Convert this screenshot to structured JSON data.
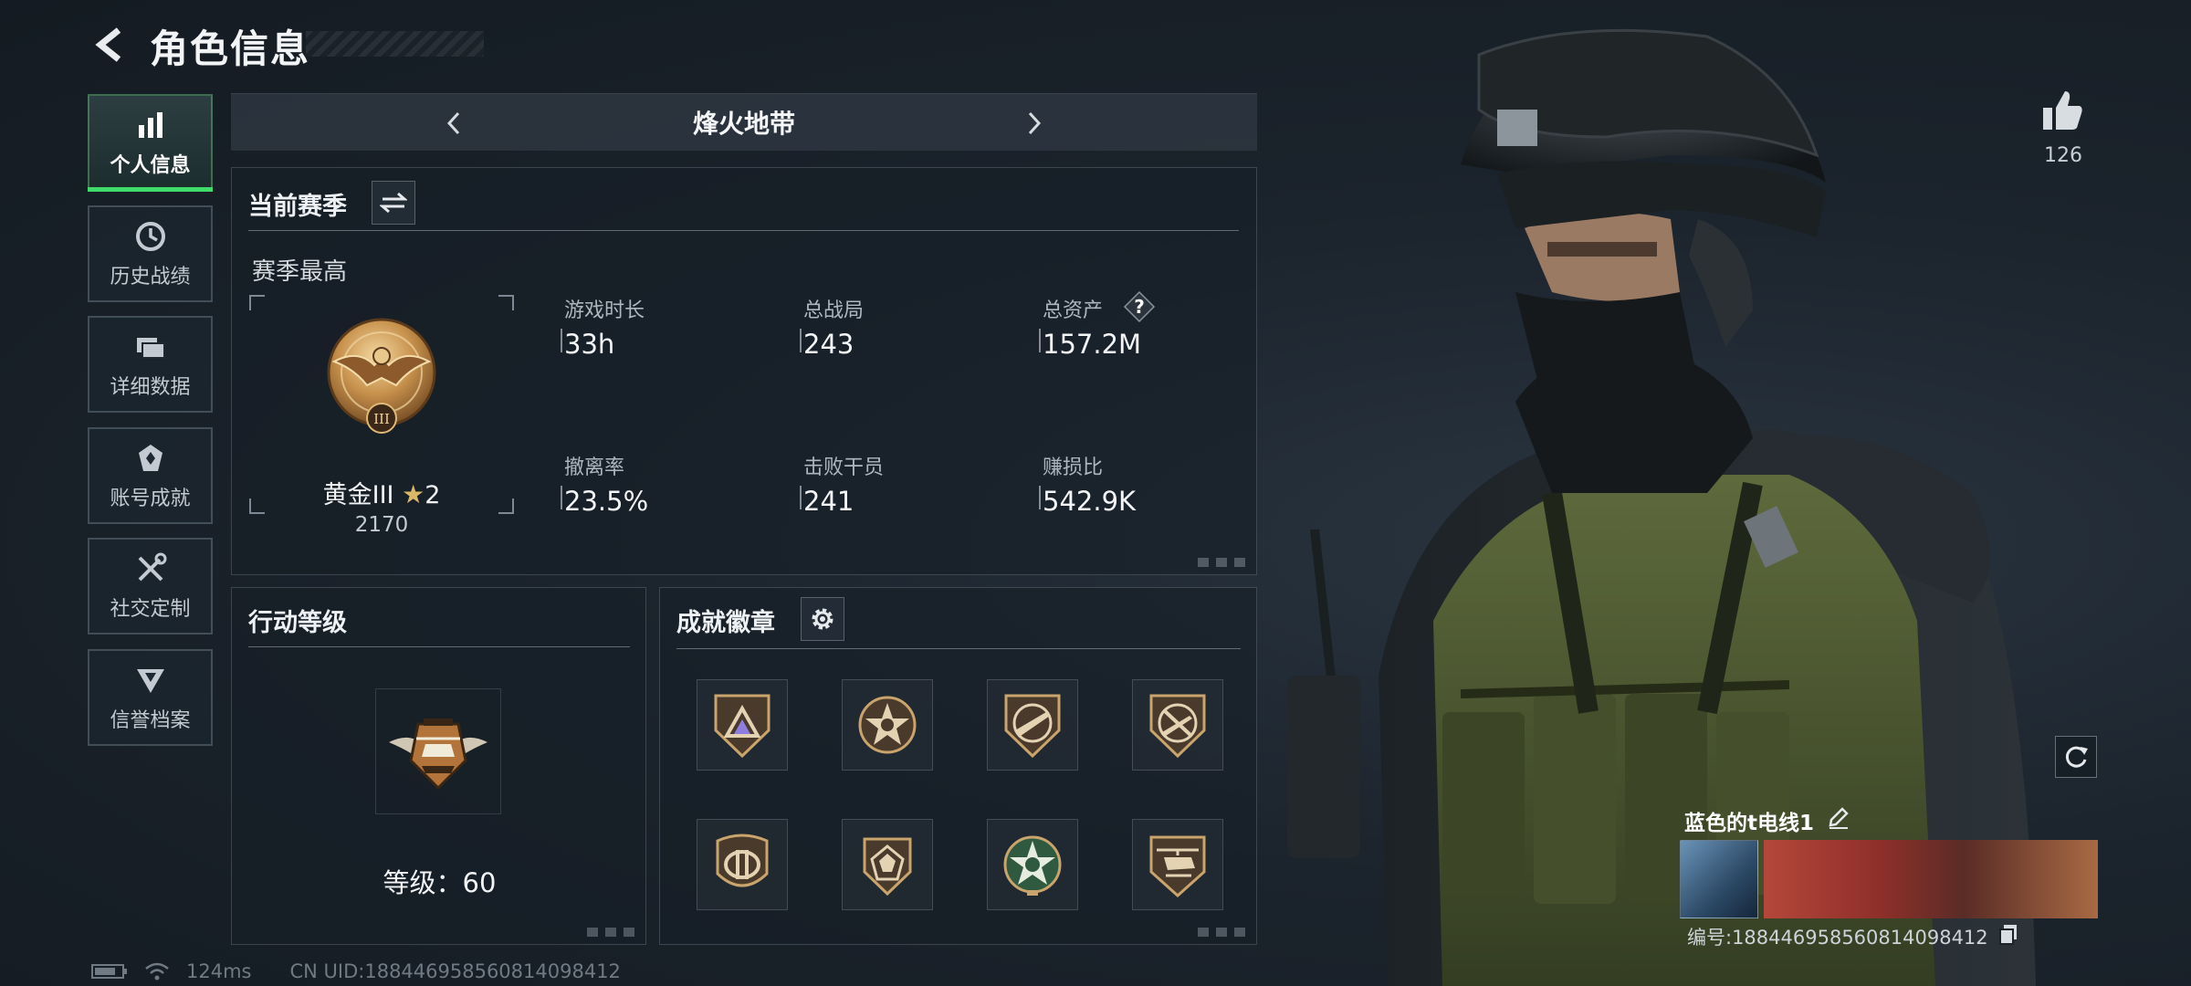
{
  "header": {
    "title": "角色信息"
  },
  "nav": {
    "items": [
      {
        "label": "个人信息",
        "icon": "bar-chart-icon",
        "active": true
      },
      {
        "label": "历史战绩",
        "icon": "history-clock-icon",
        "active": false
      },
      {
        "label": "详细数据",
        "icon": "folder-icon",
        "active": false
      },
      {
        "label": "账号成就",
        "icon": "achievement-icon",
        "active": false
      },
      {
        "label": "社交定制",
        "icon": "tools-icon",
        "active": false
      },
      {
        "label": "信誉档案",
        "icon": "reputation-icon",
        "active": false
      }
    ]
  },
  "mode": {
    "name": "烽火地带"
  },
  "season": {
    "title": "当前赛季",
    "subtitle": "赛季最高",
    "rank_name": "黄金III",
    "rank_stars": "2",
    "rank_points": "2170",
    "stats": [
      {
        "label": "游戏时长",
        "value": "33h"
      },
      {
        "label": "总战局",
        "value": "243"
      },
      {
        "label": "总资产",
        "value": "157.2M",
        "help": "?"
      },
      {
        "label": "撤离率",
        "value": "23.5%"
      },
      {
        "label": "击败干员",
        "value": "241"
      },
      {
        "label": "赚损比",
        "value": "542.9K"
      }
    ]
  },
  "action_level": {
    "title": "行动等级",
    "level_text": "等级：60"
  },
  "badges": {
    "title": "成就徽章",
    "items": [
      "triangle-shield-badge-icon",
      "star-round-badge-icon",
      "rifle-shield-badge-icon",
      "no-rifle-shield-badge-icon",
      "parallel-shield-badge-icon",
      "geometric-shield-badge-icon",
      "green-star-badge-icon",
      "helicopter-badge-icon"
    ]
  },
  "profile": {
    "likes": "126",
    "player_name": "蓝色的t电线1",
    "player_id": "编号:1884469585608140984​12"
  },
  "status": {
    "ping": "124ms",
    "uid": "CN UID:1884469585608140984​12"
  },
  "colors": {
    "accent_green": "#3fdc6b",
    "gold": "#c89b55",
    "panel_bg": "#1a222b"
  }
}
